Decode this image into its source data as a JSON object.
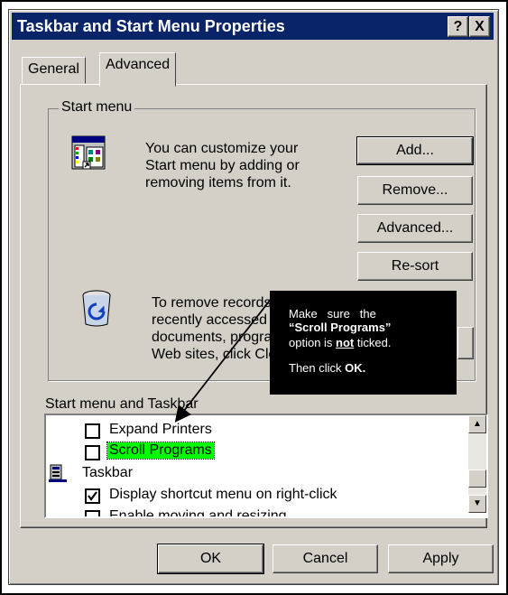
{
  "window": {
    "title": "Taskbar and Start Menu Properties",
    "help_btn": "?",
    "close_btn": "X"
  },
  "tabs": [
    {
      "label": "General"
    },
    {
      "label": "Advanced"
    }
  ],
  "start_menu": {
    "group_label": "Start menu",
    "customize_text": [
      "You can customize your",
      "Start menu by adding or",
      "removing items from it."
    ],
    "remove_text": [
      "To remove records of",
      "recently accessed",
      "documents, programs, and",
      "Web sites, click Clear."
    ],
    "buttons": {
      "add": "Add...",
      "remove": "Remove...",
      "advanced": "Advanced...",
      "resort": "Re-sort"
    }
  },
  "options": {
    "group_label": "Start menu and Taskbar",
    "items": [
      {
        "label": "Expand Printers",
        "checked": false
      },
      {
        "label": "Scroll Programs",
        "checked": false
      },
      {
        "label": "Taskbar",
        "is_header": true
      },
      {
        "label": "Display shortcut menu on right-click",
        "checked": true
      },
      {
        "label": "Enable moving and resizing",
        "checked": false
      }
    ]
  },
  "footer": {
    "ok": "OK",
    "cancel": "Cancel",
    "apply": "Apply"
  },
  "callout": {
    "line1": "Make   sure   the",
    "line2": "“Scroll Programs”",
    "line3a": "option is ",
    "line3b": "not",
    "line3c": " ticked.",
    "line4a": "Then click ",
    "line4b": "OK."
  },
  "colors": {
    "titlebar": "#0a246a",
    "highlight": "#00ff00",
    "face": "#d4d0c8"
  }
}
